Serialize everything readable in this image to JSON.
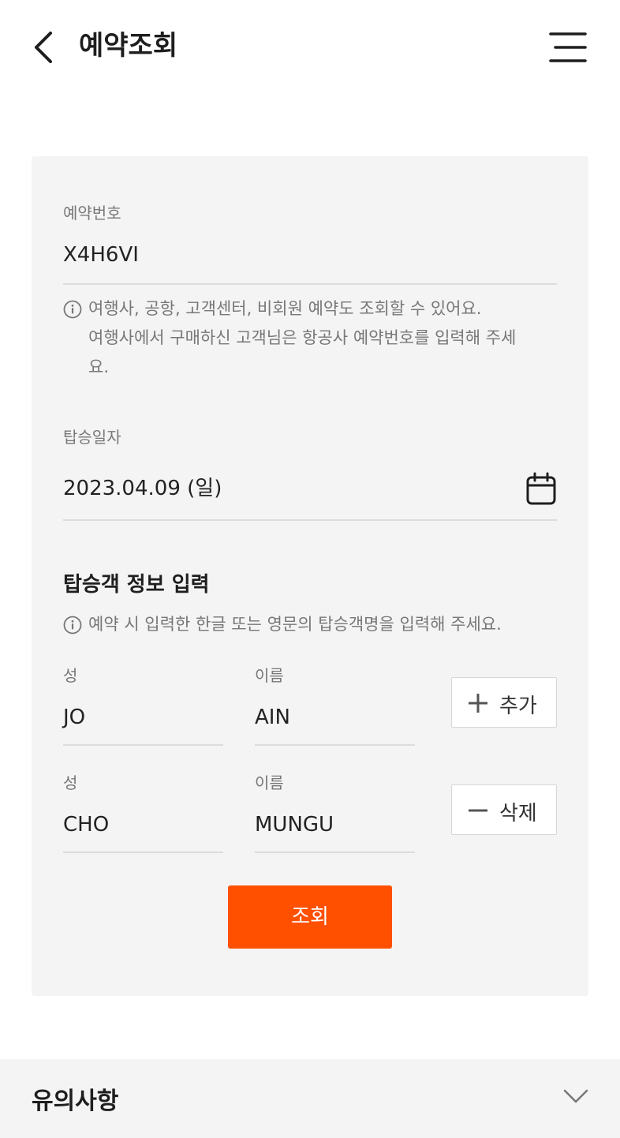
{
  "header": {
    "title": "예약조회",
    "back_icon": "chevron-left-icon",
    "menu_icon": "hamburger-menu-icon"
  },
  "form": {
    "booking": {
      "label": "예약번호",
      "value": "X4H6VI",
      "info_icon": "info-icon",
      "info_lines": [
        "여행사, 공항, 고객센터, 비회원 예약도 조회할 수 있어요.",
        "여행사에서 구매하신 고객님은 항공사 예약번호를 입력해 주세",
        "요."
      ]
    },
    "date": {
      "label": "탑승일자",
      "value": "2023.04.09 (일)",
      "calendar_icon": "calendar-icon"
    },
    "passengers": {
      "title": "탑승객 정보 입력",
      "info": "예약 시 입력한 한글 또는 영문의 탑승객명을 입력해 주세요.",
      "rows": [
        {
          "last_label": "성",
          "last_value": "JO",
          "first_label": "이름",
          "first_value": "AIN",
          "action_label": "추가",
          "action_icon": "plus-icon"
        },
        {
          "last_label": "성",
          "last_value": "CHO",
          "first_label": "이름",
          "first_value": "MUNGU",
          "action_label": "삭제",
          "action_icon": "minus-icon"
        }
      ]
    },
    "submit_label": "조회"
  },
  "notice": {
    "title": "유의사항",
    "toggle_icon": "chevron-down-icon"
  },
  "colors": {
    "accent": "#ff5000",
    "card_bg": "#f4f4f4",
    "label": "#777777",
    "text": "#222222"
  }
}
